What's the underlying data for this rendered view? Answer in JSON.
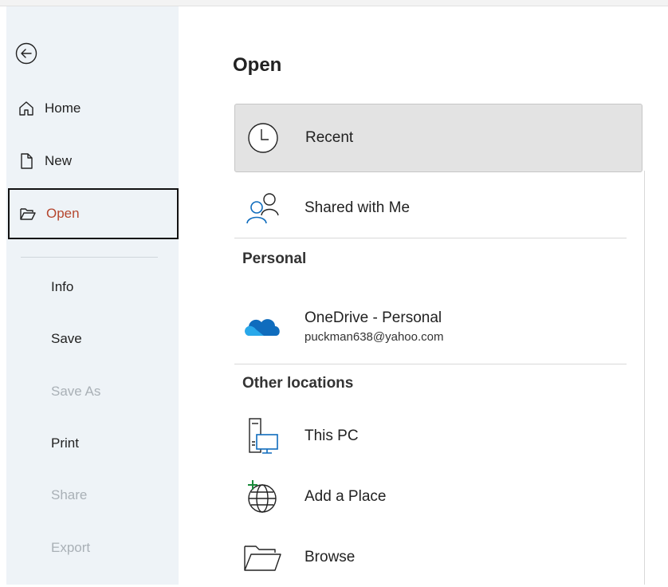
{
  "sidebar": {
    "back_label": "Back",
    "nav": [
      {
        "label": "Home",
        "icon": "home-icon"
      },
      {
        "label": "New",
        "icon": "new-document-icon"
      },
      {
        "label": "Open",
        "icon": "folder-open-icon",
        "selected": true
      }
    ],
    "items": [
      {
        "label": "Info",
        "disabled": false
      },
      {
        "label": "Save",
        "disabled": false
      },
      {
        "label": "Save As",
        "disabled": true
      },
      {
        "label": "Print",
        "disabled": false
      },
      {
        "label": "Share",
        "disabled": true
      },
      {
        "label": "Export",
        "disabled": true
      }
    ]
  },
  "main": {
    "title": "Open",
    "recent_label": "Recent",
    "shared_label": "Shared with Me",
    "personal_heading": "Personal",
    "onedrive": {
      "name": "OneDrive - Personal",
      "email": "puckman638@yahoo.com"
    },
    "other_heading": "Other locations",
    "this_pc_label": "This PC",
    "add_place_label": "Add a Place",
    "browse_label": "Browse"
  },
  "colors": {
    "accent": "#b5462e",
    "sidebar_bg": "#eef3f7",
    "selected_bg": "#e3e3e3",
    "onedrive_blue": "#0f6cbd"
  }
}
